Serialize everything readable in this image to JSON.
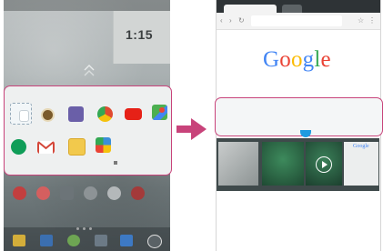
{
  "left_screen": {
    "clock": "1:15",
    "app_panel_apps": [
      {
        "icon": "multi-window-icon",
        "color": "#cfd8de"
      },
      {
        "icon": "camera-icon",
        "color": "#7a5a2b"
      },
      {
        "icon": "gallery-icon",
        "color": "#6a5fa8"
      },
      {
        "icon": "chrome-icon",
        "color": "#e04a2f"
      },
      {
        "icon": "youtube-icon",
        "color": "#e62117"
      },
      {
        "icon": "maps-icon",
        "color": "#4caf50"
      },
      {
        "icon": "hangouts-icon",
        "color": "#0f9d58"
      },
      {
        "icon": "gmail-icon",
        "color": "#d44638"
      },
      {
        "icon": "memo-icon",
        "color": "#f2c94c"
      },
      {
        "icon": "photos-icon",
        "color": "#3b8fd9"
      }
    ],
    "highlight_color": "#c8437a"
  },
  "transition_arrow_color": "#c8437a",
  "right_screen": {
    "google_logo_letters": [
      "G",
      "o",
      "o",
      "g",
      "l",
      "e"
    ],
    "mini_google": "Google",
    "control_buttons": [
      {
        "icon": "swap-icon",
        "glyph": "⟳"
      },
      {
        "icon": "app-list-icon",
        "glyph": "☰"
      },
      {
        "icon": "maximize-icon",
        "glyph": "▣"
      },
      {
        "icon": "close-icon",
        "glyph": "✕"
      }
    ]
  }
}
